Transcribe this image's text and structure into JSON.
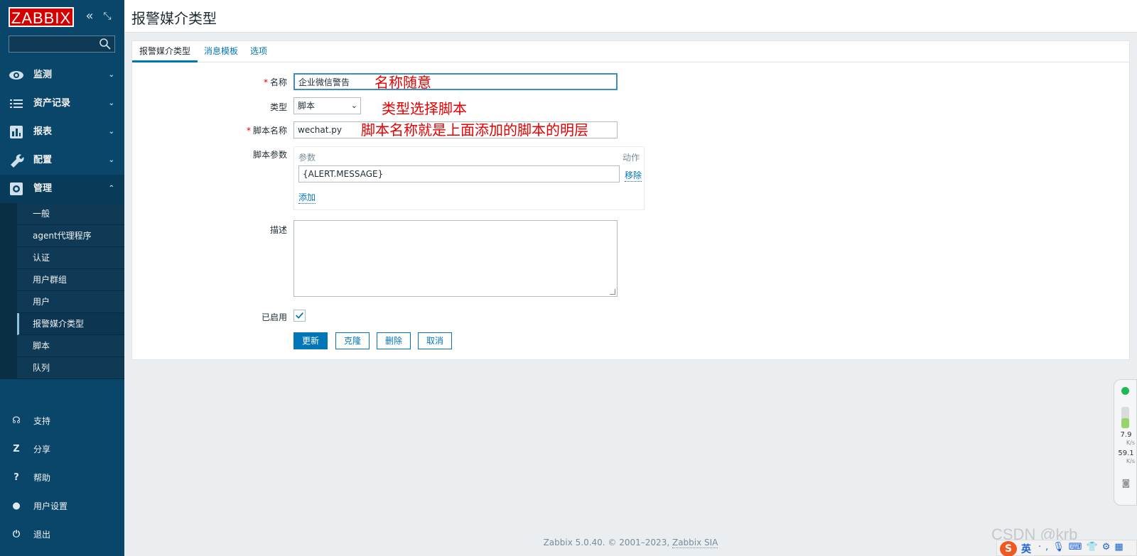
{
  "sidebar": {
    "logo": "ZABBIX",
    "search_placeholder": "",
    "menu": [
      {
        "label": "监测",
        "icon": "eye-icon"
      },
      {
        "label": "资产记录",
        "icon": "list-icon"
      },
      {
        "label": "报表",
        "icon": "bar-chart-icon"
      },
      {
        "label": "配置",
        "icon": "wrench-icon"
      },
      {
        "label": "管理",
        "icon": "gear-icon"
      }
    ],
    "submenu": [
      "一般",
      "agent代理程序",
      "认证",
      "用户群组",
      "用户",
      "报警媒介类型",
      "脚本",
      "队列"
    ],
    "bottom": [
      {
        "label": "支持",
        "icon": "headset-icon"
      },
      {
        "label": "分享",
        "icon": "share-icon"
      },
      {
        "label": "帮助",
        "icon": "help-icon"
      },
      {
        "label": "用户设置",
        "icon": "user-icon"
      },
      {
        "label": "退出",
        "icon": "power-icon"
      }
    ]
  },
  "header": {
    "title": "报警媒介类型"
  },
  "tabs": [
    "报警媒介类型",
    "消息模板",
    "选项"
  ],
  "form": {
    "name_label": "名称",
    "name_value": "企业微信警告",
    "type_label": "类型",
    "type_value": "脚本",
    "script_label": "脚本名称",
    "script_value": "wechat.py",
    "params_label": "脚本参数",
    "params_col": "参数",
    "params_action_col": "动作",
    "param_value": "{ALERT.MESSAGE}",
    "remove_link": "移除",
    "add_link": "添加",
    "desc_label": "描述",
    "enabled_label": "已启用",
    "enabled": true
  },
  "buttons": {
    "update": "更新",
    "clone": "克隆",
    "delete": "删除",
    "cancel": "取消"
  },
  "annotations": {
    "a1": "名称随意",
    "a2": "类型选择脚本",
    "a3": "脚本名称就是上面添加的脚本的明层"
  },
  "footer": {
    "text": "Zabbix 5.0.40. © 2001–2023, ",
    "link": "Zabbix SIA"
  },
  "widget": {
    "up": "7.9",
    "up_unit": "K/s",
    "down": "59.1",
    "down_unit": "K/s"
  },
  "watermark": "CSDN @krb",
  "ime": {
    "logo": "S",
    "lang": "英"
  },
  "colors": {
    "sidebar": "#0a466a",
    "accent": "#0275b8",
    "annotation": "#e60000",
    "logo_red": "#d40000"
  }
}
